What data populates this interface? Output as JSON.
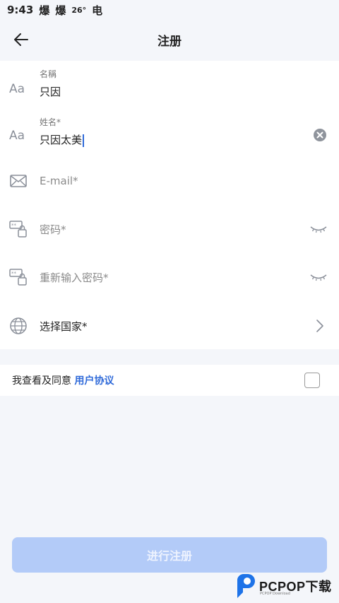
{
  "status_bar": {
    "time": "9:43",
    "icons": [
      "爆",
      "爆"
    ],
    "temperature": "26°",
    "extra_icon": "电"
  },
  "header": {
    "title": "注册",
    "back_icon": "arrow-left-icon"
  },
  "form": {
    "nickname": {
      "label": "名稱",
      "value": "只因",
      "icon": "font-icon"
    },
    "name": {
      "label": "姓名*",
      "value": "只因太美",
      "icon": "font-icon",
      "clear_icon": "clear-icon"
    },
    "email": {
      "placeholder": "E-mail*",
      "icon": "mail-icon"
    },
    "password": {
      "placeholder": "密码*",
      "icon": "password-icon",
      "toggle_icon": "eye-closed-icon"
    },
    "password_confirm": {
      "placeholder": "重新输入密码*",
      "icon": "password-icon",
      "toggle_icon": "eye-closed-icon"
    },
    "country": {
      "label": "选择国家*",
      "icon": "globe-icon",
      "chevron_icon": "chevron-right-icon"
    }
  },
  "agreement": {
    "text": "我查看及同意",
    "link": "用户协议",
    "checked": false
  },
  "submit": {
    "label": "进行注册",
    "color": "#b3cbf8"
  },
  "watermark": {
    "brand": "PCPOP下载",
    "sub": "PCPOP Download"
  },
  "colors": {
    "accent": "#2f6ad9",
    "background": "#f4f6fa"
  }
}
